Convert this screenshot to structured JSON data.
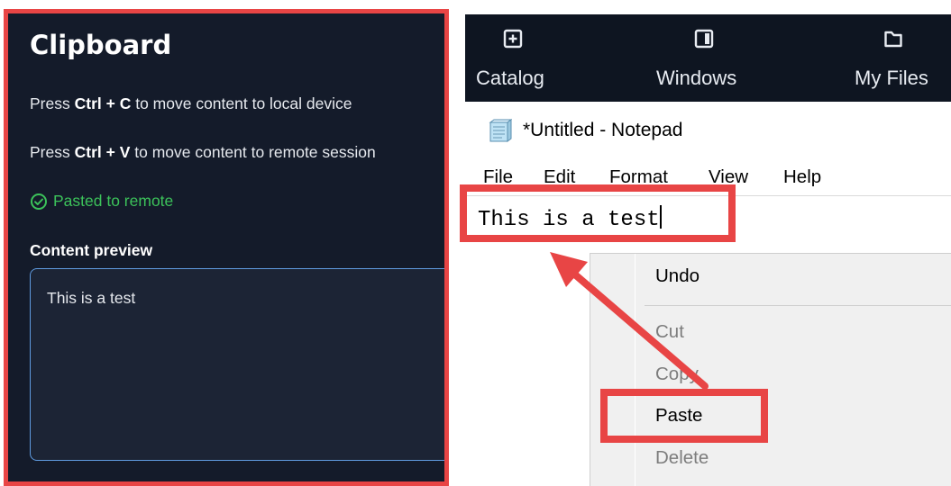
{
  "clipboard": {
    "title": "Clipboard",
    "instr_copy_prefix": "Press ",
    "instr_copy_keys": "Ctrl + C",
    "instr_copy_suffix": " to move content to local device",
    "instr_paste_prefix": "Press ",
    "instr_paste_keys": "Ctrl + V",
    "instr_paste_suffix": " to move content to remote session",
    "status": "Pasted to remote",
    "preview_label": "Content preview",
    "preview_text": "This is a test"
  },
  "toolbar": {
    "items": [
      {
        "label": "Catalog",
        "icon": "plus-square-icon"
      },
      {
        "label": "Windows",
        "icon": "window-icon"
      },
      {
        "label": "My Files",
        "icon": "folder-icon"
      }
    ]
  },
  "notepad": {
    "title": "*Untitled - Notepad",
    "menu": [
      "File",
      "Edit",
      "Format",
      "View",
      "Help"
    ],
    "text": "This is a test"
  },
  "context_menu": {
    "items": [
      {
        "label": "Undo",
        "enabled": true
      },
      {
        "label": "Cut",
        "enabled": false
      },
      {
        "label": "Copy",
        "enabled": false
      },
      {
        "label": "Paste",
        "enabled": true
      },
      {
        "label": "Delete",
        "enabled": false
      }
    ]
  },
  "colors": {
    "panel_bg": "#141b2a",
    "highlight_red": "#e84545",
    "success_green": "#3cc25a",
    "accent_blue": "#5f9be0"
  }
}
